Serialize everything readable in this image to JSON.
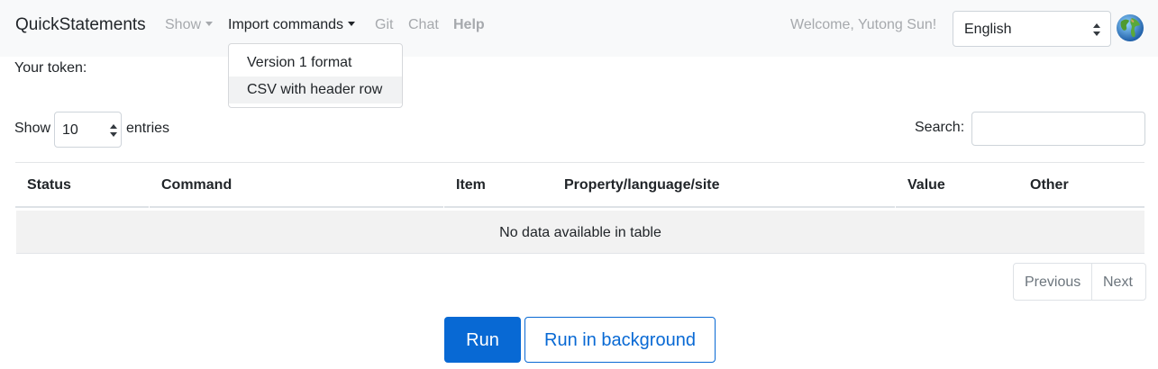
{
  "navbar": {
    "brand": "QuickStatements",
    "links": {
      "show": "Show",
      "import": "Import commands",
      "git": "Git",
      "chat": "Chat",
      "help": "Help"
    },
    "welcome": "Welcome, Yutong Sun!",
    "language": {
      "selected": "English"
    },
    "globe_icon": "globe-icon"
  },
  "dropdown": {
    "items": [
      "Version 1 format",
      "CSV with header row"
    ],
    "hovered_index": 1
  },
  "token_label": "Your token:",
  "table_controls": {
    "show_label": "Show",
    "entries_value": "10",
    "entries_label": "entries",
    "search_label": "Search:",
    "search_value": ""
  },
  "table": {
    "columns": [
      "Status",
      "Command",
      "Item",
      "Property/language/site",
      "Value",
      "Other"
    ],
    "empty_message": "No data available in table"
  },
  "pagination": {
    "previous": "Previous",
    "next": "Next"
  },
  "actions": {
    "run": "Run",
    "run_background": "Run in background"
  },
  "colors": {
    "primary": "#0869d4",
    "navbar_bg": "#f8f9fa",
    "muted": "#a6a9ad"
  }
}
